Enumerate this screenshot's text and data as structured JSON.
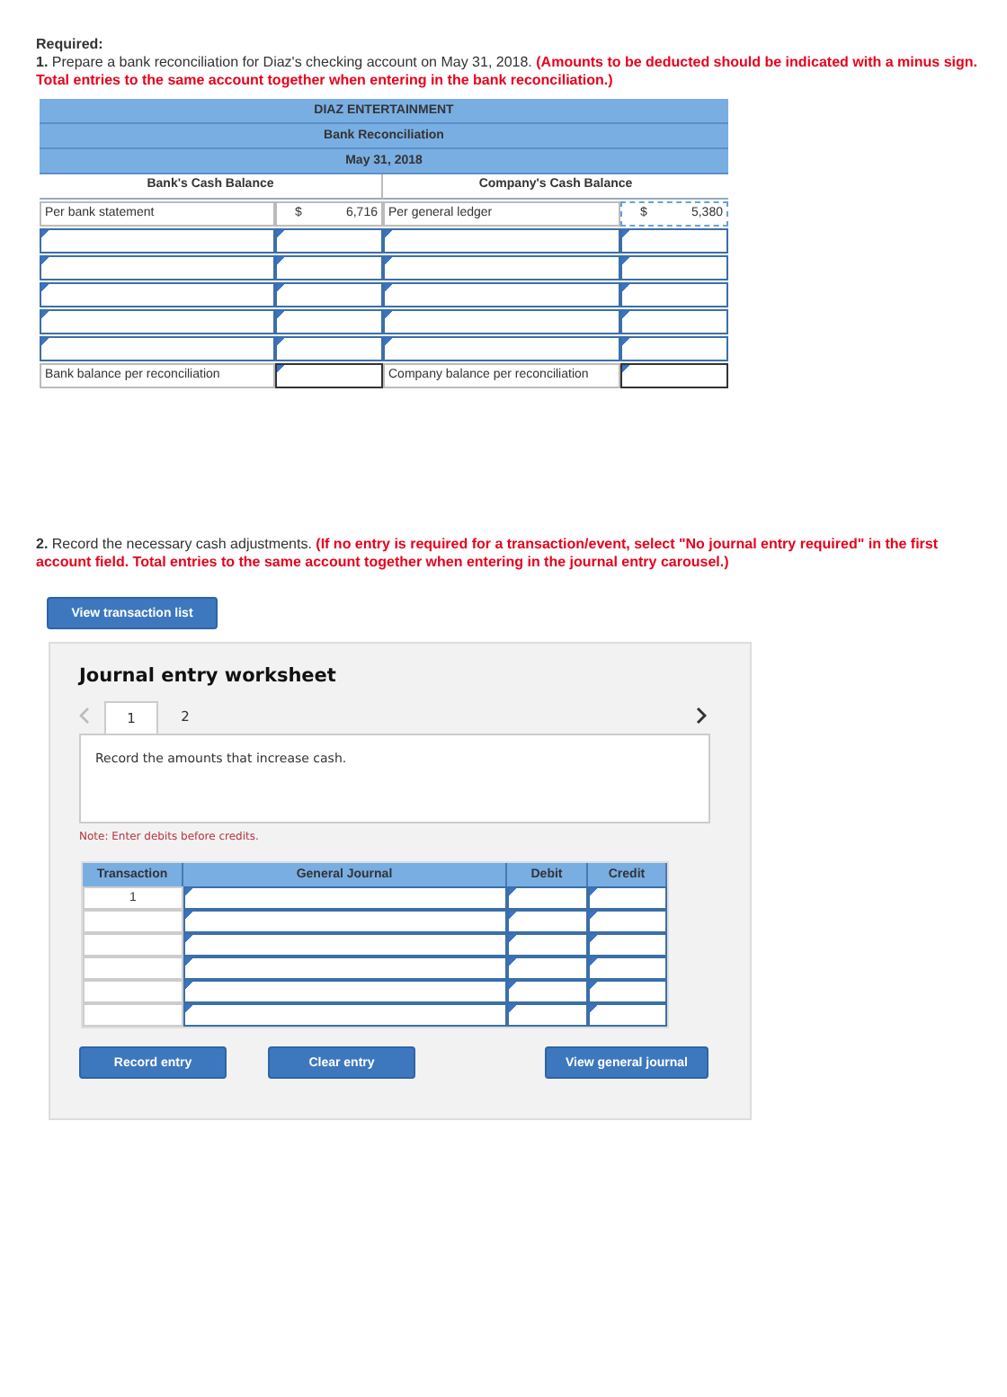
{
  "required_heading": "Required:",
  "part1": {
    "instruction": "**1.** Prepare a bank reconciliation for Diaz's checking account on May 31, 2018.",
    "note": "(Amounts to be deducted should be indicated with a minus sign. Total entries to the same account together when entering in the bank reconciliation.)"
  },
  "reconciliation": {
    "title_lines": [
      "DIAZ ENTERTAINMENT",
      "Bank Reconciliation",
      "May 31, 2018"
    ],
    "bank_heading": "Bank's Cash Balance",
    "company_heading": "Company's Cash Balance",
    "bank_start": {
      "label": "Per bank statement",
      "currency": "$",
      "amount": "6,716"
    },
    "company_start": {
      "label": "Per general ledger",
      "currency": "$",
      "amount": "5,380"
    },
    "entry_rows": [
      {
        "kind": "blank"
      },
      {
        "kind": "blank"
      },
      {
        "kind": "blank"
      },
      {
        "kind": "blank"
      },
      {
        "kind": "blank"
      }
    ],
    "bank_end": {
      "label": "Bank balance per reconciliation"
    },
    "company_end": {
      "label": "Company balance per reconciliation"
    }
  },
  "part2": {
    "instruction": "**2.** Record the necessary cash adjustments.",
    "note": "(If no entry is required for a transaction/event, select \"No journal entry required\" in the first account field. Total entries to the same account together when entering in the journal entry carousel.)"
  },
  "view_transaction_button": "View transaction list",
  "worksheet": {
    "title": "Journal entry worksheet",
    "tabs": [
      {
        "label": "1",
        "selected": true
      },
      {
        "label": "2",
        "selected": false
      }
    ],
    "prompt": "Record the amounts that increase cash.",
    "note": "Note: Enter debits before credits.",
    "columns": [
      "Transaction",
      "General Journal",
      "Debit",
      "Credit"
    ],
    "rows": [
      {
        "transaction": "1"
      },
      {
        "transaction": ""
      },
      {
        "transaction": ""
      },
      {
        "transaction": ""
      },
      {
        "transaction": ""
      },
      {
        "transaction": ""
      }
    ],
    "buttons": [
      "Record entry",
      "Clear entry",
      "View general journal"
    ]
  }
}
